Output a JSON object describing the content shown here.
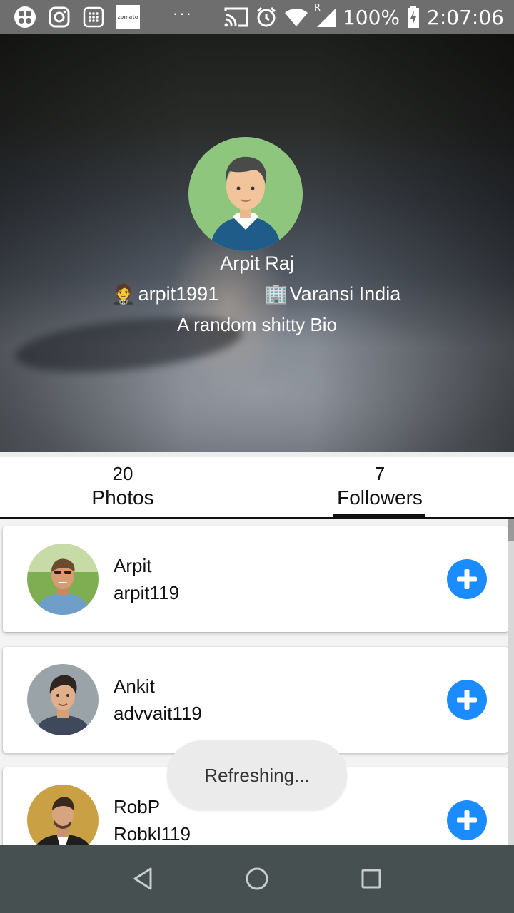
{
  "status_bar": {
    "battery": "100%",
    "time": "2:07:06",
    "dots": "···",
    "zomato_label": "zomato",
    "network_letter": "R"
  },
  "profile": {
    "name": "Arpit Raj",
    "username_emoji": "🤵",
    "username": "arpit1991",
    "location_emoji": "🏢",
    "location": "Varansi India",
    "bio": "A random shitty Bio"
  },
  "tabs": {
    "photos": {
      "count": "20",
      "label": "Photos"
    },
    "followers": {
      "count": "7",
      "label": "Followers"
    },
    "selected": "Followers"
  },
  "followers": [
    {
      "name": "Arpit",
      "handle": "arpit119"
    },
    {
      "name": "Ankit",
      "handle": "advvait119"
    },
    {
      "name": "RobP",
      "handle": "Robkl119"
    }
  ],
  "toast": {
    "text": "Refreshing..."
  },
  "colors": {
    "accent_blue": "#1a8cff",
    "navbar": "#465050",
    "status_bar": "#6e6e6e",
    "avatar_bg": "#8ec67e"
  }
}
